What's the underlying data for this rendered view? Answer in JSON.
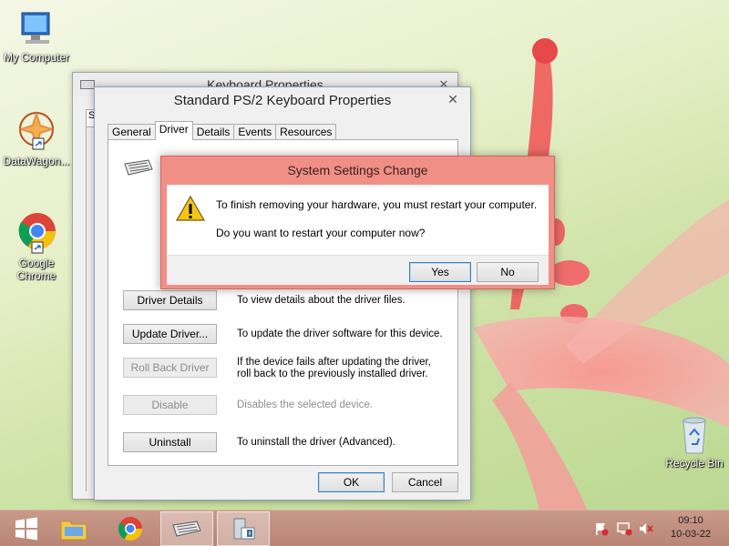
{
  "desktop": {
    "icons": [
      {
        "label": "My Computer"
      },
      {
        "label": "DataWagon..."
      },
      {
        "label": "Google Chrome"
      },
      {
        "label": "Recycle Bin"
      }
    ]
  },
  "back_window": {
    "title": "Keyboard Properties",
    "close": "✕",
    "tab_stub": "S"
  },
  "properties": {
    "title": "Standard PS/2 Keyboard Properties",
    "close": "✕",
    "tabs": [
      "General",
      "Driver",
      "Details",
      "Events",
      "Resources"
    ],
    "active_tab": "Driver",
    "buttons": [
      {
        "label": "Driver Details",
        "desc": "To view details about the driver files.",
        "enabled": true
      },
      {
        "label": "Update Driver...",
        "desc": "To update the driver software for this device.",
        "enabled": true
      },
      {
        "label": "Roll Back Driver",
        "desc": "If the device fails after updating the driver, roll back to the previously installed driver.",
        "enabled": false
      },
      {
        "label": "Disable",
        "desc": "Disables the selected device.",
        "enabled": false
      },
      {
        "label": "Uninstall",
        "desc": "To uninstall the driver (Advanced).",
        "enabled": true
      }
    ],
    "ok_label": "OK",
    "cancel_label": "Cancel"
  },
  "dialog": {
    "title": "System Settings Change",
    "message_1": "To finish removing your hardware, you must restart your computer.",
    "message_2": "Do you want to restart your computer now?",
    "yes_label": "Yes",
    "no_label": "No"
  },
  "taskbar": {
    "time": "09:10",
    "date": "10-03-22"
  },
  "colors": {
    "dialog_accent": "#f08f86",
    "taskbar": "#c0907f"
  }
}
